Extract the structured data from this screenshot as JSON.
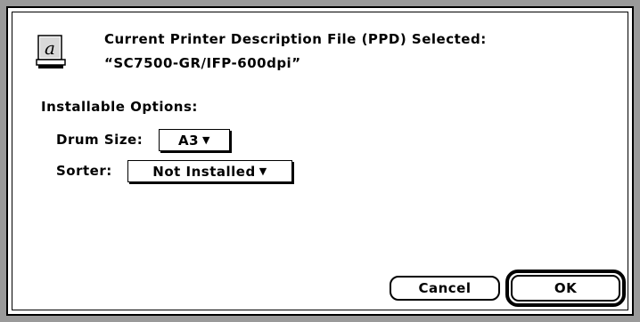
{
  "dialog": {
    "title_line": "Current Printer Description File (PPD) Selected:",
    "ppd_file": "“SC7500-GR/IFP-600dpi”",
    "icon": "ppd-document-icon"
  },
  "options": {
    "section_label": "Installable Options:",
    "drum_size": {
      "label": "Drum Size:",
      "value": "A3"
    },
    "sorter": {
      "label": "Sorter:",
      "value": "Not Installed"
    }
  },
  "buttons": {
    "cancel": "Cancel",
    "ok": "OK"
  }
}
